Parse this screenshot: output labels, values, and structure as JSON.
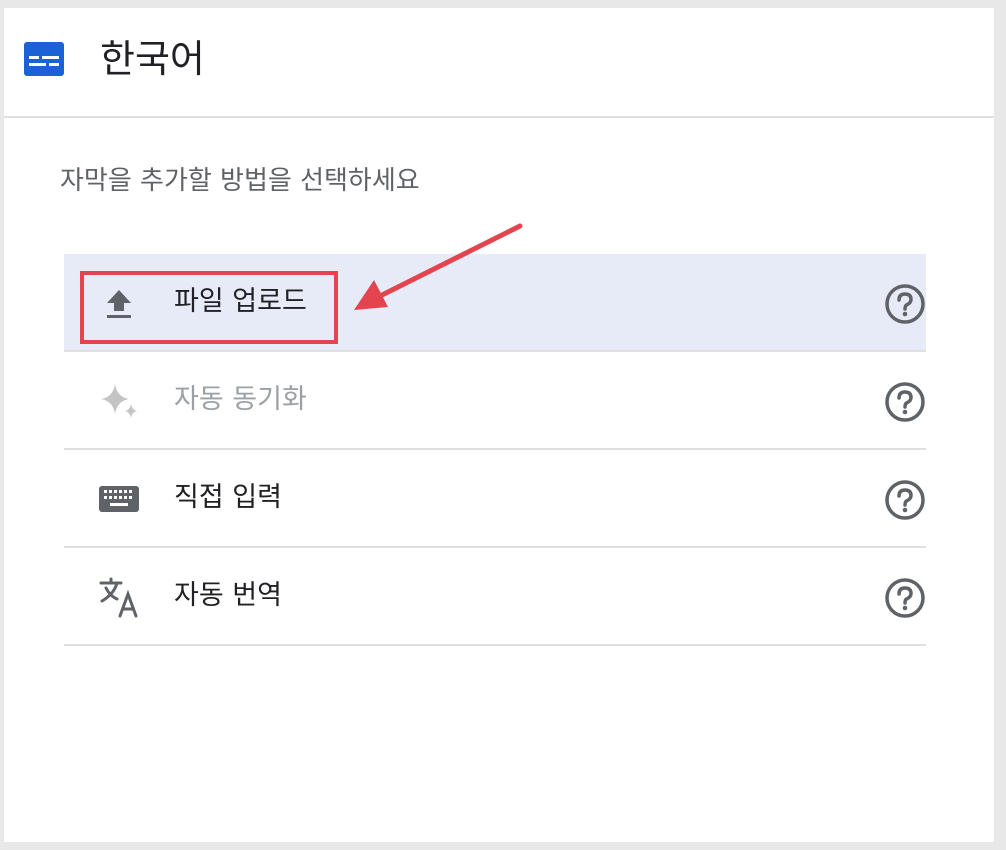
{
  "header": {
    "title": "한국어",
    "icon": "subtitles-icon",
    "icon_color": "#1a62d6"
  },
  "instruction": "자막을 추가할 방법을 선택하세요",
  "options": [
    {
      "label": "파일 업로드",
      "icon": "upload-icon",
      "selected": true,
      "disabled": false
    },
    {
      "label": "자동 동기화",
      "icon": "sparkle-icon",
      "selected": false,
      "disabled": true
    },
    {
      "label": "직접 입력",
      "icon": "keyboard-icon",
      "selected": false,
      "disabled": false
    },
    {
      "label": "자동 번역",
      "icon": "translate-icon",
      "selected": false,
      "disabled": false
    }
  ],
  "colors": {
    "selected_bg": "#e6ebf7",
    "annotation": "#e3444d",
    "icon_gray": "#5f6368",
    "disabled_gray": "#bdbdbd"
  }
}
